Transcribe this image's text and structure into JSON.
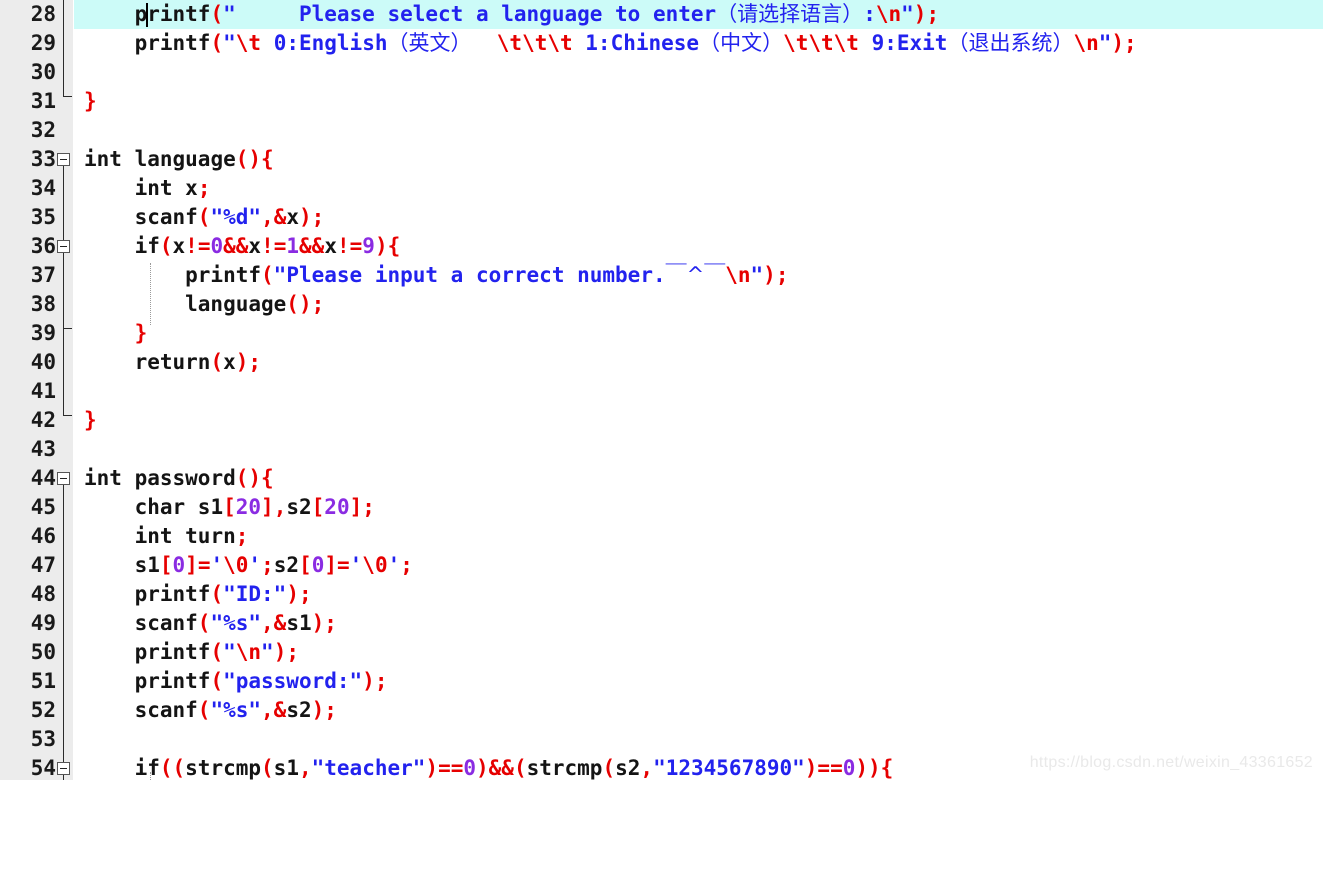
{
  "editor": {
    "app_kind": "c-source-code-editor",
    "language": "C",
    "first_visible_line": 28,
    "last_visible_line": 54,
    "current_line": 28,
    "caret_line": 28,
    "caret_column": 10,
    "colors": {
      "background": "#ffffff",
      "gutter_background": "#ececec",
      "current_line_highlight": "#ccfbf8",
      "line_number": "#1a1a1a",
      "identifier": "#141414",
      "punctuation": "#e60000",
      "string": "#2222ee",
      "escape": "#e60000",
      "number": "#8a2be2",
      "watermark": "#e9e9e9"
    }
  },
  "watermark": {
    "text": "https://blog.csdn.net/weixin_43361652"
  },
  "lines": [
    {
      "n": "28",
      "text": "    printf(\"     Please select a language to enter（请选择语言）:\\n\");"
    },
    {
      "n": "29",
      "text": "    printf(\"\\t 0:English（英文）  \\t\\t\\t 1:Chinese（中文）\\t\\t\\t 9:Exit（退出系统）\\n\");"
    },
    {
      "n": "30",
      "text": ""
    },
    {
      "n": "31",
      "text": "}"
    },
    {
      "n": "32",
      "text": ""
    },
    {
      "n": "33",
      "text": "int language(){"
    },
    {
      "n": "34",
      "text": "    int x;"
    },
    {
      "n": "35",
      "text": "    scanf(\"%d\",&x);"
    },
    {
      "n": "36",
      "text": "    if(x!=0&&x!=1&&x!=9){"
    },
    {
      "n": "37",
      "text": "        printf(\"Please input a correct number.￣^￣\\n\");"
    },
    {
      "n": "38",
      "text": "        language();"
    },
    {
      "n": "39",
      "text": "    }"
    },
    {
      "n": "40",
      "text": "    return(x);"
    },
    {
      "n": "41",
      "text": ""
    },
    {
      "n": "42",
      "text": "}"
    },
    {
      "n": "43",
      "text": ""
    },
    {
      "n": "44",
      "text": "int password(){"
    },
    {
      "n": "45",
      "text": "    char s1[20],s2[20];"
    },
    {
      "n": "46",
      "text": "    int turn;"
    },
    {
      "n": "47",
      "text": "    s1[0]='\\0';s2[0]='\\0';"
    },
    {
      "n": "48",
      "text": "    printf(\"ID:\");"
    },
    {
      "n": "49",
      "text": "    scanf(\"%s\",&s1);"
    },
    {
      "n": "50",
      "text": "    printf(\"\\n\");"
    },
    {
      "n": "51",
      "text": "    printf(\"password:\");"
    },
    {
      "n": "52",
      "text": "    scanf(\"%s\",&s2);"
    },
    {
      "n": "53",
      "text": ""
    },
    {
      "n": "54",
      "text": "    if((strcmp(s1,\"teacher\")==0)&&(strcmp(s2,\"1234567890\")==0)){"
    }
  ],
  "fold_markers": [
    {
      "line": "33",
      "state": "expanded",
      "glyph": "minus-box"
    },
    {
      "line": "36",
      "state": "expanded",
      "glyph": "minus-box"
    },
    {
      "line": "44",
      "state": "expanded",
      "glyph": "minus-box"
    },
    {
      "line": "54",
      "state": "expanded",
      "glyph": "minus-box"
    }
  ],
  "line_numbers": [
    "28",
    "29",
    "30",
    "31",
    "32",
    "33",
    "34",
    "35",
    "36",
    "37",
    "38",
    "39",
    "40",
    "41",
    "42",
    "43",
    "44",
    "45",
    "46",
    "47",
    "48",
    "49",
    "50",
    "51",
    "52",
    "53",
    "54"
  ]
}
